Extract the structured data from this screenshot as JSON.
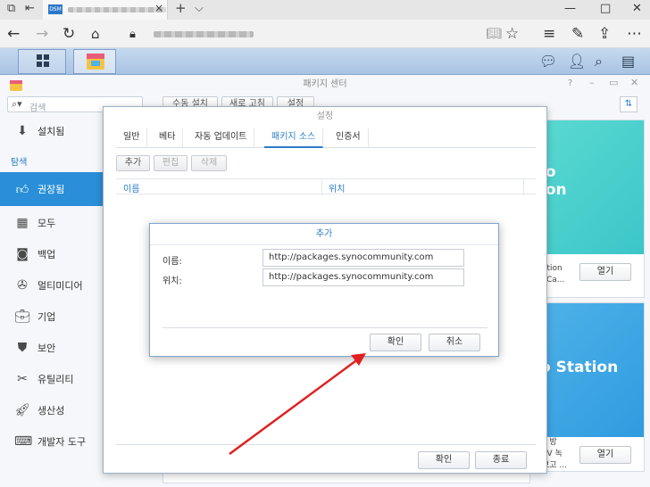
{
  "browser": {
    "tab_favicon_text": "DSM",
    "close_glyph": "×",
    "new_tab_glyph": "+",
    "tabs_menu_glyph": "⌵",
    "window_minimize": "—",
    "window_maximize": "□",
    "window_close": "✕"
  },
  "package_center": {
    "title": "패키지 센터",
    "search_placeholder": "검색",
    "top_buttons": [
      "수동 설치",
      "새로 고침",
      "설정"
    ],
    "sidebar": {
      "installed": "설치됨",
      "section_label": "탐색",
      "items": [
        "권장됨",
        "모두",
        "백업",
        "멀티미디어",
        "기업",
        "보안",
        "유틸리티",
        "생산성",
        "개발자 도구"
      ]
    },
    "cards": [
      {
        "title": "io\nion",
        "desc": "ation\nTCa...",
        "open": "열기",
        "color": "#3cc6c9"
      },
      {
        "title": "o Station",
        "desc": "E 방\nTV 녹\n보고 ...",
        "open": "열기",
        "color": "#2f9be0"
      }
    ]
  },
  "settings": {
    "title": "설정",
    "tabs": [
      "일반",
      "베타",
      "자동 업데이트",
      "패키지 소스",
      "인증서"
    ],
    "active_tab": "패키지 소스",
    "buttons": {
      "add": "추가",
      "edit": "편집",
      "delete": "삭제"
    },
    "columns": {
      "name": "이름",
      "location": "위치"
    },
    "footer": {
      "ok": "확인",
      "close": "종료"
    }
  },
  "add_dialog": {
    "title": "추가",
    "name_label": "이름:",
    "name_value": "http://packages.synocommunity.com",
    "location_label": "위치:",
    "location_value": "http://packages.synocommunity.com",
    "ok": "확인",
    "cancel": "취소"
  },
  "annotation": {
    "arrow_color": "#e02020"
  }
}
